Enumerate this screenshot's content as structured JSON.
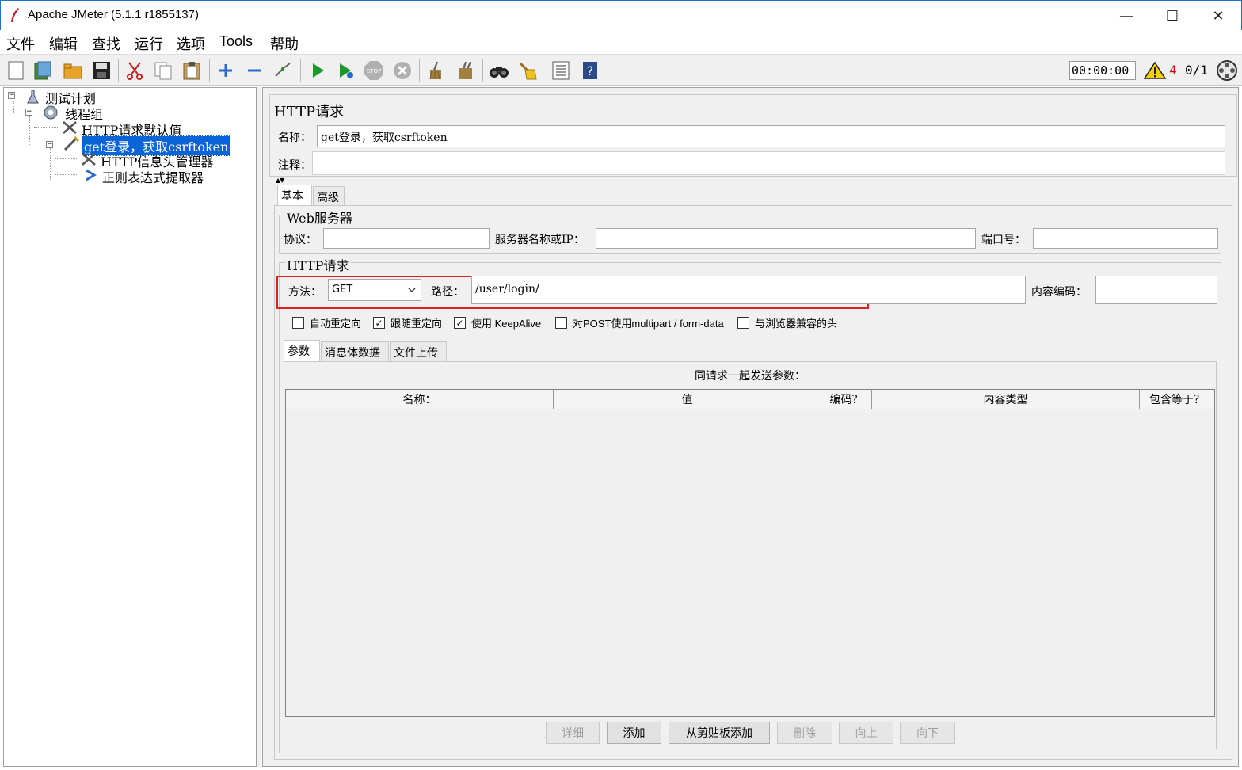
{
  "window": {
    "title": "Apache JMeter (5.1.1 r1855137)",
    "minimize": "—",
    "maximize": "☐",
    "close": "✕"
  },
  "menu": [
    "文件",
    "编辑",
    "查找",
    "运行",
    "选项",
    "Tools",
    "帮助"
  ],
  "toolbar": {
    "timer": "00:00:00",
    "warning_count": "4",
    "threads": "0/1",
    "icons": [
      "new-icon",
      "templates-icon",
      "open-icon",
      "save-icon",
      "cut-icon",
      "copy-icon",
      "paste-icon",
      "expand-icon",
      "collapse-icon",
      "toggle-icon",
      "start-icon",
      "start-no-pause-icon",
      "stop-icon",
      "shutdown-icon",
      "clear-icon",
      "clear-all-icon",
      "search-icon",
      "reset-search-icon",
      "function-helper-icon",
      "help-icon"
    ]
  },
  "tree": {
    "items": [
      {
        "label": "测试计划"
      },
      {
        "label": "线程组"
      },
      {
        "label": "HTTP请求默认值"
      },
      {
        "label": "get登录，获取csrftoken"
      },
      {
        "label": "HTTP信息头管理器"
      },
      {
        "label": "正则表达式提取器"
      }
    ]
  },
  "panel": {
    "title": "HTTP请求",
    "name_label": "名称：",
    "name_value": "get登录，获取csrftoken",
    "comment_label": "注释：",
    "comment_value": "",
    "tabs": [
      "基本",
      "高级"
    ],
    "web_server": {
      "title": "Web服务器",
      "protocol_label": "协议：",
      "protocol_value": "",
      "server_label": "服务器名称或IP：",
      "server_value": "",
      "port_label": "端口号：",
      "port_value": ""
    },
    "http_request": {
      "title": "HTTP请求",
      "method_label": "方法：",
      "method_value": "GET",
      "path_label": "路径：",
      "path_value": "/user/login/",
      "encoding_label": "内容编码：",
      "encoding_value": ""
    },
    "checkboxes": [
      {
        "label": "自动重定向",
        "checked": false
      },
      {
        "label": "跟随重定向",
        "checked": true
      },
      {
        "label": "使用 KeepAlive",
        "checked": true
      },
      {
        "label": "对POST使用multipart / form-data",
        "checked": false
      },
      {
        "label": "与浏览器兼容的头",
        "checked": false
      }
    ],
    "sub_tabs": [
      "参数",
      "消息体数据",
      "文件上传"
    ],
    "params": {
      "caption": "同请求一起发送参数：",
      "columns": [
        "名称：",
        "值",
        "编码？",
        "内容类型",
        "包含等于？"
      ]
    },
    "buttons": [
      {
        "label": "详细",
        "enabled": false
      },
      {
        "label": "添加",
        "enabled": true
      },
      {
        "label": "从剪贴板添加",
        "enabled": true
      },
      {
        "label": "删除",
        "enabled": false
      },
      {
        "label": "向上",
        "enabled": false
      },
      {
        "label": "向下",
        "enabled": false
      }
    ]
  },
  "colors": {
    "selection": "#0a64d8",
    "highlight_box": "#e02020",
    "warning": "#e00000"
  }
}
